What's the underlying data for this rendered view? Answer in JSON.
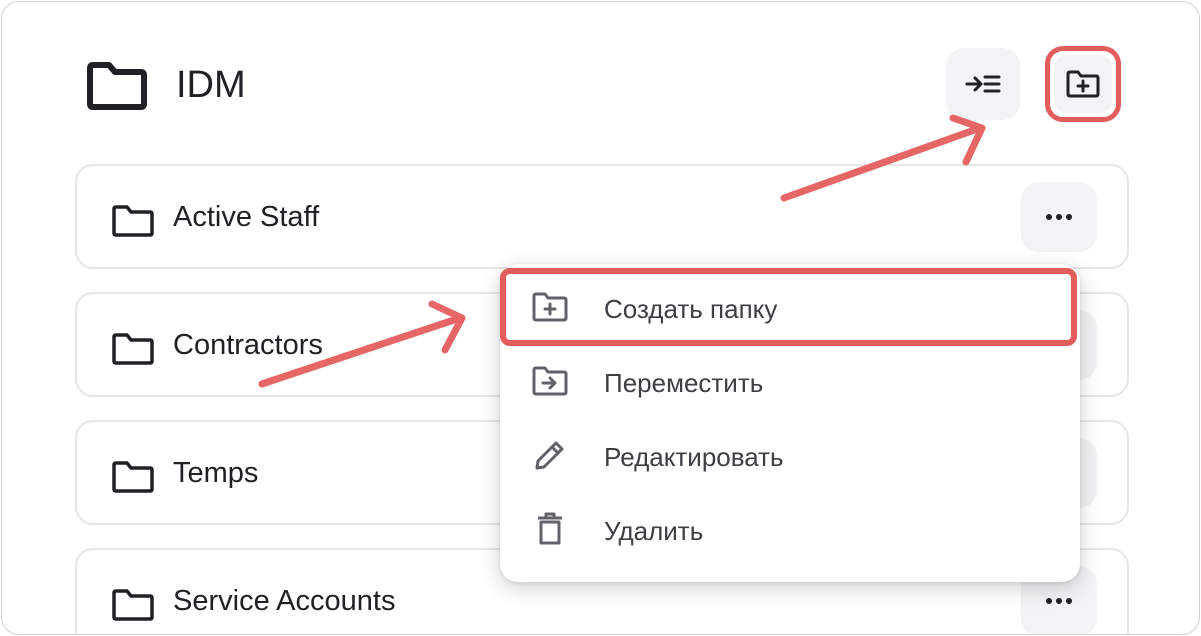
{
  "header": {
    "title": "IDM",
    "folder_icon": "folder-icon",
    "buttons": [
      {
        "icon": "move-to-folder-icon"
      },
      {
        "icon": "create-folder-icon",
        "highlighted": true
      }
    ]
  },
  "folders": [
    {
      "label": "Active Staff"
    },
    {
      "label": "Contractors"
    },
    {
      "label": "Temps"
    },
    {
      "label": "Service Accounts"
    }
  ],
  "context_menu": {
    "items": [
      {
        "label": "Создать папку",
        "icon": "create-folder-icon",
        "highlighted": true
      },
      {
        "label": "Переместить",
        "icon": "move-folder-icon"
      },
      {
        "label": "Редактировать",
        "icon": "pencil-icon"
      },
      {
        "label": "Удалить",
        "icon": "trash-icon"
      }
    ]
  },
  "colors": {
    "annotation_red": "#e35d5d",
    "button_bg": "#f1f3f4",
    "text": "#202124",
    "icon_gray": "#5f6368"
  }
}
